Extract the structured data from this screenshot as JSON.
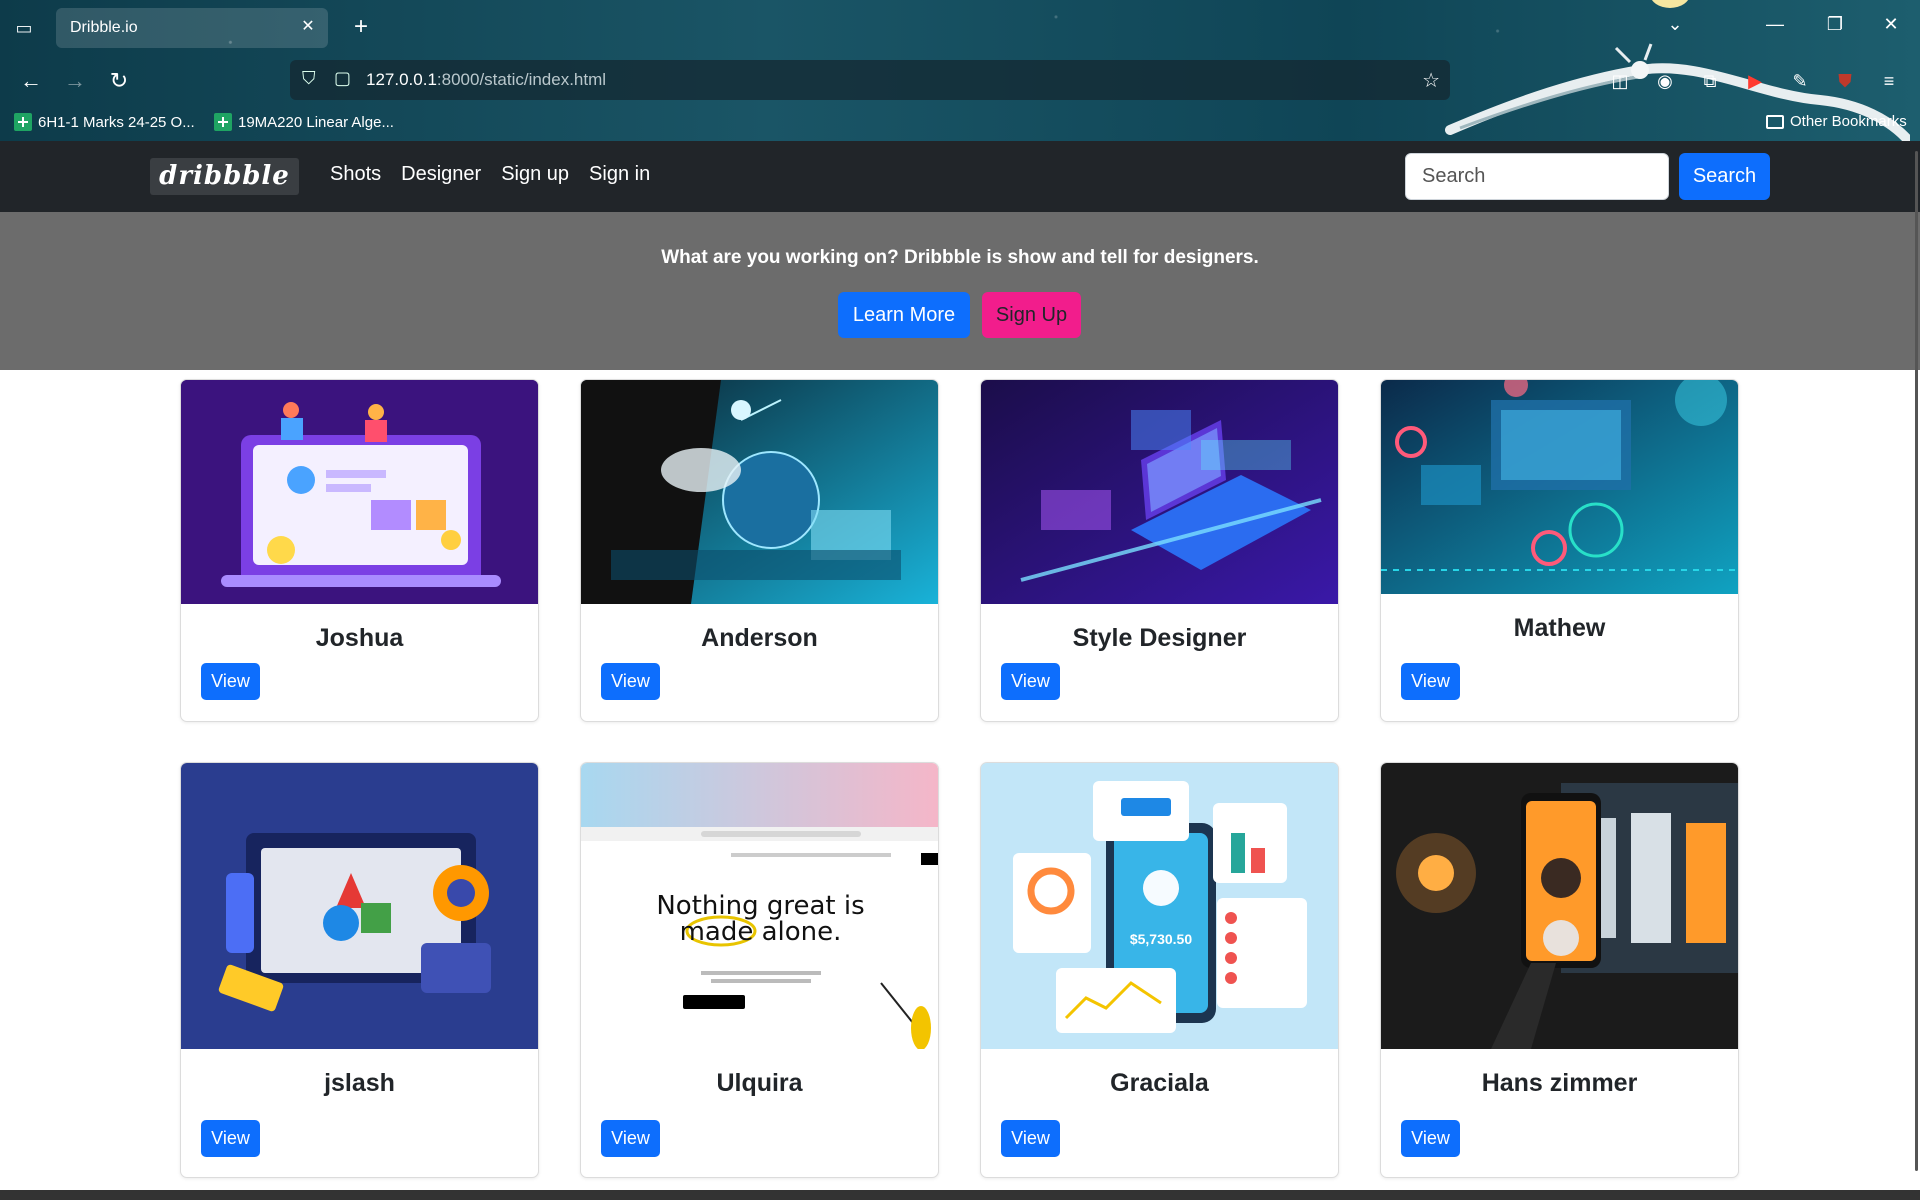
{
  "browser": {
    "tab_title": "Dribble.io",
    "url_host": "127.0.0.1",
    "url_path": ":8000/static/index.html",
    "bookmarks": [
      {
        "label": "6H1-1 Marks 24-25 O..."
      },
      {
        "label": "19MA220 Linear Alge..."
      }
    ],
    "other_bookmarks": "Other Bookmarks"
  },
  "nav": {
    "brand": "dribbble",
    "links": [
      "Shots",
      "Designer",
      "Sign up",
      "Sign in"
    ],
    "search_placeholder": "Search",
    "search_button": "Search"
  },
  "hero": {
    "text": "What are you working on? Dribbble is show and tell for designers.",
    "learn_more": "Learn More",
    "sign_up": "Sign Up"
  },
  "cards": [
    {
      "title": "Joshua",
      "button": "View"
    },
    {
      "title": "Anderson",
      "button": "View"
    },
    {
      "title": "Style Designer",
      "button": "View"
    },
    {
      "title": "Mathew",
      "button": "View"
    },
    {
      "title": "jslash",
      "button": "View"
    },
    {
      "title": "Ulquira",
      "button": "View"
    },
    {
      "title": "Graciala",
      "button": "View"
    },
    {
      "title": "Hans zimmer",
      "button": "View"
    }
  ],
  "card_images": {
    "ulquira_headline_1": "Nothing great is",
    "ulquira_headline_2": "made alone.",
    "graciala_amount": "$5,730.50"
  },
  "colors": {
    "primary": "#0d6efd",
    "pink": "#f21d8c",
    "navbar": "#212529",
    "hero": "#6c6c6c"
  }
}
